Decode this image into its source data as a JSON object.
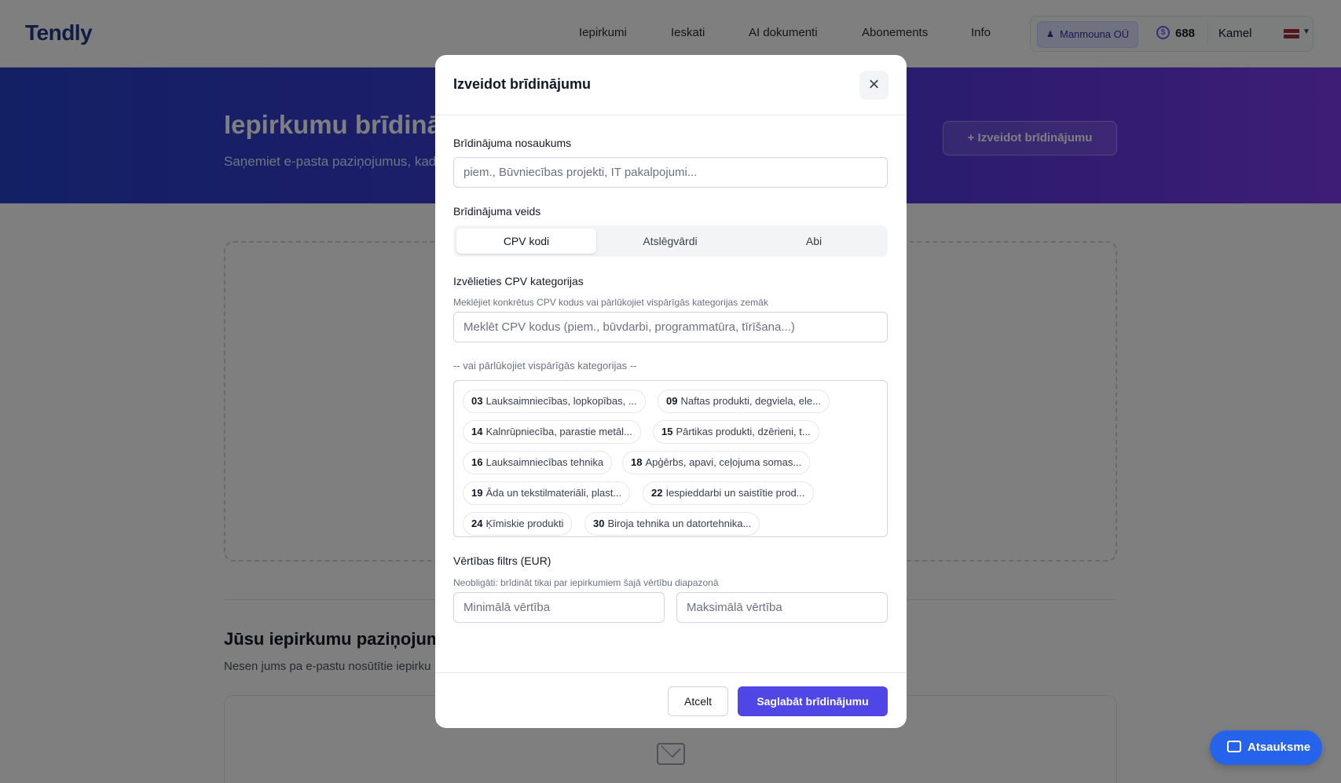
{
  "app": {
    "logo": "Tendly"
  },
  "nav": {
    "links": [
      "Iepirkumi",
      "Ieskati",
      "AI dokumenti",
      "Abonements",
      "Info"
    ],
    "org_name": "Manmouna OÜ",
    "credits": "688",
    "user": "Kamel",
    "language_flag": "LV"
  },
  "hero": {
    "title": "Iepirkumu brīdinājumi",
    "subtitle": "Saņemiet e-pasta paziņojumus, kad jā",
    "create_button": "Izveidot brīdinājumu",
    "create_button_icon": "+"
  },
  "notifications": {
    "title": "Jūsu iepirkumu paziņojumi",
    "subtitle": "Nesen jums pa e-pastu nosūtītie iepirku"
  },
  "feedback_button": "Atsauksme",
  "modal": {
    "title": "Izveidot brīdinājumu",
    "name_label": "Brīdinājuma nosaukums",
    "name_placeholder": "piem., Būvniecības projekti, IT pakalpojumi...",
    "type_label": "Brīdinājuma veids",
    "type_options": [
      "CPV kodi",
      "Atslēgvārdi",
      "Abi"
    ],
    "type_selected": "CPV kodi",
    "cpv_label": "Izvēlieties CPV kategorijas",
    "cpv_hint": "Meklējiet konkrētus CPV kodus vai pārlūkojiet vispārīgās kategorijas zemāk",
    "cpv_search_placeholder": "Meklēt CPV kodus (piem., būvdarbi, programmatūra, tīrīšana...)",
    "browse_label": "-- vai pārlūkojiet vispārīgās kategorijas --",
    "categories": [
      {
        "code": "03",
        "name": "Lauksaimniecības, lopkopības, ..."
      },
      {
        "code": "09",
        "name": "Naftas produkti, degviela, ele..."
      },
      {
        "code": "14",
        "name": "Kalnrūpniecība, parastie metāl..."
      },
      {
        "code": "15",
        "name": "Pārtikas produkti, dzērieni, t..."
      },
      {
        "code": "16",
        "name": "Lauksaimniecības tehnika"
      },
      {
        "code": "18",
        "name": "Apģērbs, apavi, ceļojuma somas..."
      },
      {
        "code": "19",
        "name": "Āda un tekstilmateriāli, plast..."
      },
      {
        "code": "22",
        "name": "Iespieddarbi un saistītie prod..."
      },
      {
        "code": "24",
        "name": "Ķīmiskie produkti"
      },
      {
        "code": "30",
        "name": "Biroja tehnika un datortehnika..."
      }
    ],
    "value_label": "Vērtības filtrs (EUR)",
    "value_hint": "Neobligāti: brīdināt tikai par iepirkumiem šajā vērtību diapazonā",
    "min_placeholder": "Minimālā vērtība",
    "max_placeholder": "Maksimālā vērtība",
    "cancel_button": "Atcelt",
    "save_button": "Saglabāt brīdinājumu"
  }
}
